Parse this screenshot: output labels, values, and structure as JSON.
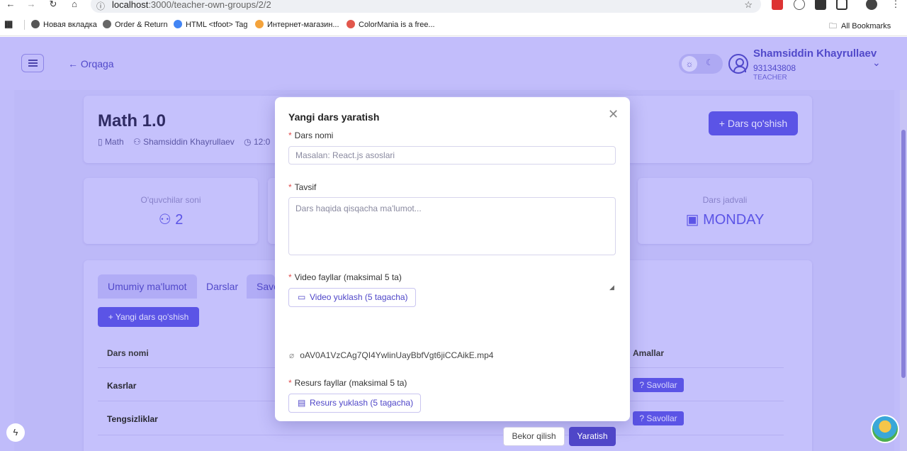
{
  "browser": {
    "url_host": "localhost",
    "url_path": ":3000/teacher-own-groups/2/2",
    "bookmarks": [
      "Новая вкладка",
      "Order & Return",
      "HTML <tfoot> Tag",
      "Интернет-магазин...",
      "ColorMania is a free..."
    ],
    "all_bookmarks": "All Bookmarks"
  },
  "header": {
    "back_label": "Orqaga",
    "user_name": "Shamsiddin Khayrullaev",
    "user_phone": "931343808",
    "user_role": "TEACHER"
  },
  "group": {
    "title": "Math 1.0",
    "subject": "Math",
    "teacher": "Shamsiddin Khayrullaev",
    "time": "12:0",
    "add_lesson_label": "+ Dars qo'shish"
  },
  "stats": {
    "students_label": "O'quvchilar soni",
    "students_value": "2",
    "schedule_label": "Dars jadvali",
    "schedule_value": "MONDAY"
  },
  "tabs": [
    "Umumiy ma'lumot",
    "Darslar",
    "Savo"
  ],
  "lessons": {
    "add_label": "+ Yangi dars qo'shish",
    "col_name": "Dars nomi",
    "col_actions": "Amallar",
    "rows": [
      {
        "name": "Kasrlar",
        "action": "Savollar"
      },
      {
        "name": "Tengsizliklar",
        "action": "Savollar"
      }
    ]
  },
  "modal": {
    "title": "Yangi dars yaratish",
    "name_label": "Dars nomi",
    "name_placeholder": "Masalan: React.js asoslari",
    "desc_label": "Tavsif",
    "desc_placeholder": "Dars haqida qisqacha ma'lumot...",
    "video_label": "Video fayllar (maksimal 5 ta)",
    "video_button": "Video yuklash (5 tagacha)",
    "video_file": "oAV0A1VzCAg7QI4YwlinUayBbfVgt6jiCCAikE.mp4",
    "resource_label": "Resurs fayllar (maksimal 5 ta)",
    "resource_button": "Resurs yuklash (5 tagacha)",
    "cancel": "Bekor qilish",
    "submit": "Yaratish"
  },
  "colors": {
    "accent": "#4f46c8",
    "background": "#c7c3fc",
    "required": "#e24b4b"
  }
}
